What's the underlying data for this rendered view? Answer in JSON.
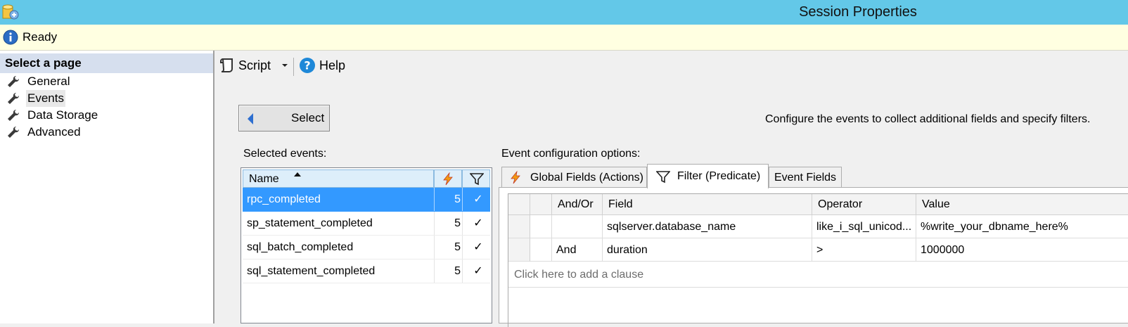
{
  "window": {
    "title": "Session Properties"
  },
  "status": {
    "text": "Ready",
    "icon": "info-icon"
  },
  "page_selector": {
    "header": "Select a page",
    "items": [
      {
        "label": "General",
        "icon": "wrench-icon",
        "selected": false
      },
      {
        "label": "Events",
        "icon": "wrench-icon",
        "selected": true
      },
      {
        "label": "Data Storage",
        "icon": "wrench-icon",
        "selected": false
      },
      {
        "label": "Advanced",
        "icon": "wrench-icon",
        "selected": false
      }
    ]
  },
  "toolbar": {
    "script_label": "Script",
    "help_label": "Help"
  },
  "select_button": {
    "label": "Select"
  },
  "description": "Configure the events to collect additional fields and specify filters.",
  "selected_events": {
    "label": "Selected events:",
    "columns": {
      "name": "Name"
    },
    "rows": [
      {
        "name": "rpc_completed",
        "count": "5",
        "filtered": "✓",
        "selected": true
      },
      {
        "name": "sp_statement_completed",
        "count": "5",
        "filtered": "✓",
        "selected": false
      },
      {
        "name": "sql_batch_completed",
        "count": "5",
        "filtered": "✓",
        "selected": false
      },
      {
        "name": "sql_statement_completed",
        "count": "5",
        "filtered": "✓",
        "selected": false
      }
    ]
  },
  "config": {
    "label": "Event configuration options:",
    "tabs": [
      {
        "label": "Global Fields (Actions)",
        "icon": "lightning-icon",
        "active": false
      },
      {
        "label": "Filter (Predicate)",
        "icon": "filter-icon",
        "active": true
      },
      {
        "label": "Event Fields",
        "active": false
      }
    ],
    "filter_grid": {
      "columns": {
        "and_or": "And/Or",
        "field": "Field",
        "operator": "Operator",
        "value": "Value"
      },
      "rows": [
        {
          "and_or": "",
          "field": "sqlserver.database_name",
          "operator": "like_i_sql_unicod...",
          "value": "%write_your_dbname_here%"
        },
        {
          "and_or": "And",
          "field": "duration",
          "operator": ">",
          "value": "1000000"
        }
      ],
      "add_clause": "Click here to add a clause"
    }
  },
  "colors": {
    "titlebar": "#63c8e8",
    "statusbar": "#ffffe1",
    "selection": "#3399ff",
    "help_icon": "#1e88d8"
  }
}
